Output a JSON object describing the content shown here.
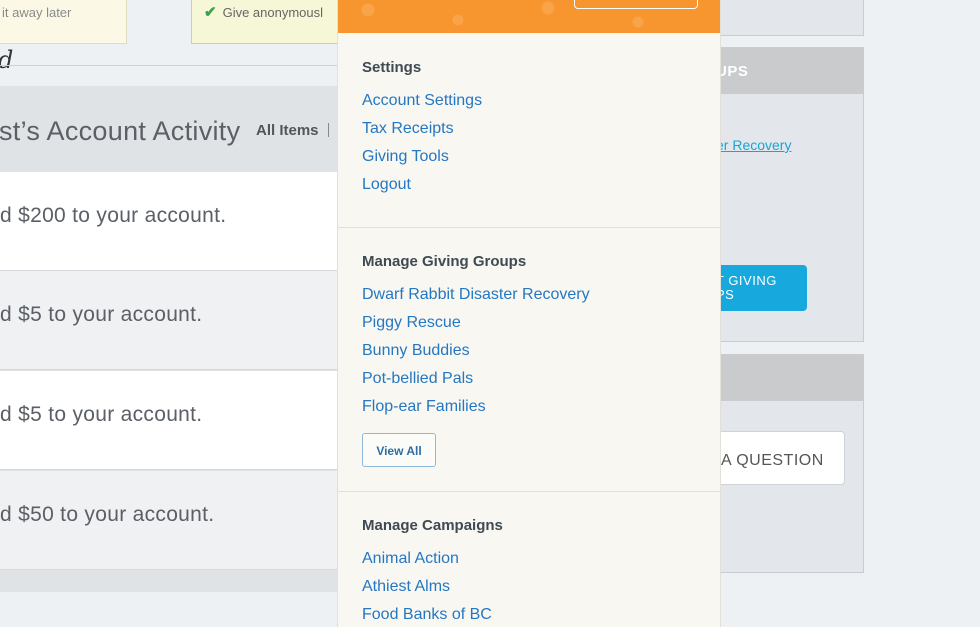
{
  "background": {
    "tip_left": "it away later",
    "tip_mid": "Give anonymousl",
    "script_fragment": "d",
    "activity": {
      "title": "st’s Account Activity",
      "filter_label": "All Items",
      "rows": [
        "d $200 to your account.",
        "d $5 to your account.",
        "d $5 to your account.",
        "d $50 to your account."
      ]
    },
    "sidebar": {
      "groups_header": "UPS",
      "groups_link": "er Recovery",
      "groups_button_line1": "T GIVING",
      "groups_button_line2": "PS",
      "ask_button": "A QUESTION"
    }
  },
  "menu": {
    "settings": {
      "title": "Settings",
      "links": [
        "Account Settings",
        "Tax Receipts",
        "Giving Tools",
        "Logout"
      ]
    },
    "giving_groups": {
      "title": "Manage Giving Groups",
      "links": [
        "Dwarf Rabbit Disaster Recovery",
        "Piggy Rescue",
        "Bunny Buddies",
        "Pot-bellied Pals",
        "Flop-ear Families"
      ],
      "view_all": "View All"
    },
    "campaigns": {
      "title": "Manage Campaigns",
      "links": [
        "Animal Action",
        "Athiest Alms",
        "Food Banks of BC"
      ]
    }
  },
  "colors": {
    "banner": "#f7952e",
    "link": "#2577c2",
    "accent_button": "#17a8de"
  }
}
